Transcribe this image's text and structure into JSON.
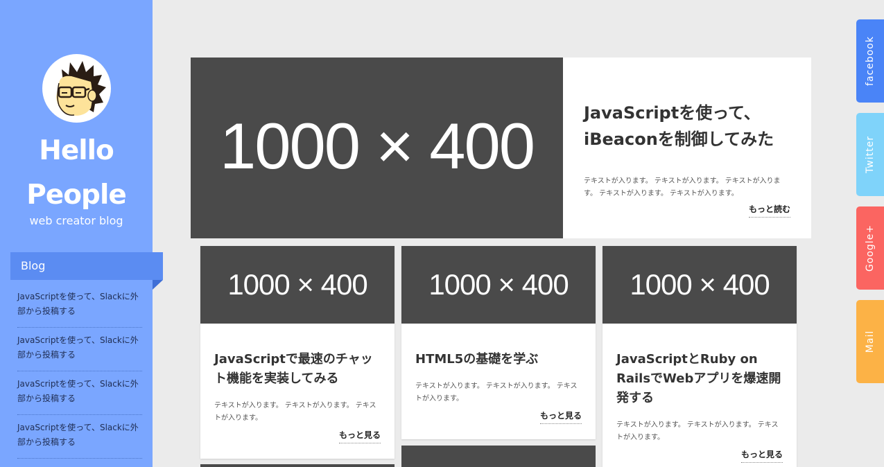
{
  "site": {
    "title_line1": "Hello",
    "title_line2": "People",
    "tagline": "web creator blog"
  },
  "sidebar": {
    "heading": "Blog",
    "items": [
      {
        "label": "JavaScriptを使って、Slackに外部から投稿する"
      },
      {
        "label": "JavaScriptを使って、Slackに外部から投稿する"
      },
      {
        "label": "JavaScriptを使って、Slackに外部から投稿する"
      },
      {
        "label": "JavaScriptを使って、Slackに外部から投稿する"
      }
    ]
  },
  "featured": {
    "image_label": "1000 × 400",
    "title": "JavaScriptを使って、iBeaconを制御してみた",
    "text": "テキストが入ります。 テキストが入ります。 テキストが入ります。 テキストが入ります。 テキストが入ります。",
    "more": "もっと読む"
  },
  "cards": [
    {
      "image_label": "1000 × 400",
      "title": "JavaScriptで最速のチャット機能を実装してみる",
      "text": "テキストが入ります。 テキストが入ります。 テキストが入ります。",
      "more": "もっと見る"
    },
    {
      "image_label": "1000 × 400",
      "title": "HTML5の基礎を学ぶ",
      "text": "テキストが入ります。 テキストが入ります。 テキストが入ります。",
      "more": "もっと見る"
    },
    {
      "image_label": "1000 × 400",
      "title": "JavaScriptとRuby on RailsでWebアプリを爆速開発する",
      "text": "テキストが入ります。 テキストが入ります。 テキストが入ります。",
      "more": "もっと見る"
    }
  ],
  "social": [
    {
      "label": "facebook",
      "color": "#4a84f7"
    },
    {
      "label": "Twitter",
      "color": "#7fd3fa"
    },
    {
      "label": "Google+",
      "color": "#fb6561"
    },
    {
      "label": "Mail",
      "color": "#fcb246"
    }
  ],
  "colors": {
    "sidebar_bg": "#7aa6ff",
    "sidebar_heading_bg": "#5b8cf2",
    "page_bg": "#ebebeb",
    "image_placeholder": "#4a4a4a"
  }
}
